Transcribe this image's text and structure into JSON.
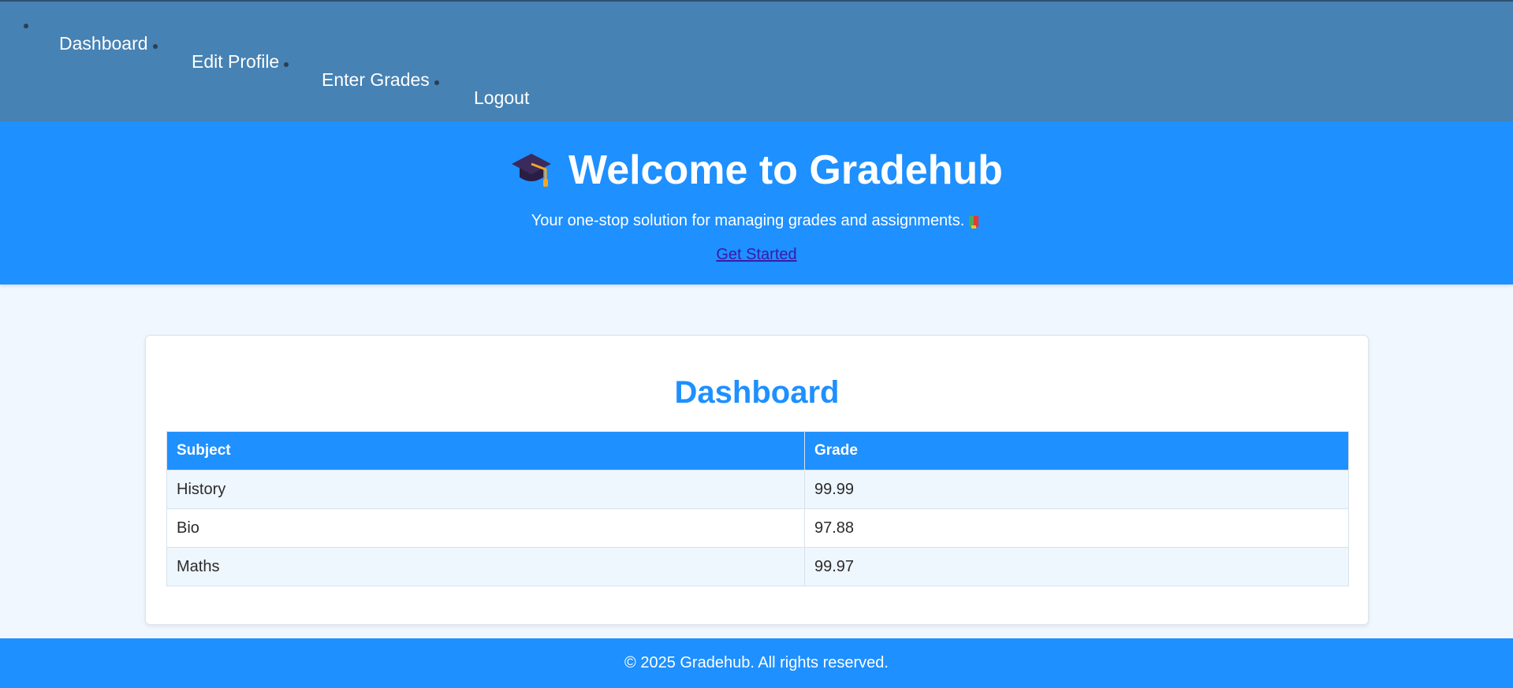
{
  "nav": {
    "items": [
      {
        "label": "Dashboard"
      },
      {
        "label": "Edit Profile"
      },
      {
        "label": "Enter Grades"
      },
      {
        "label": "Logout"
      }
    ]
  },
  "hero": {
    "title": "Welcome to Gradehub",
    "title_icon": "graduation-cap-icon",
    "tagline": "Your one-stop solution for managing grades and assignments.",
    "tagline_icon": "books-icon",
    "cta_label": "Get Started"
  },
  "dashboard": {
    "title": "Dashboard",
    "columns": [
      "Subject",
      "Grade"
    ],
    "rows": [
      {
        "subject": "History",
        "grade": "99.99"
      },
      {
        "subject": "Bio",
        "grade": "97.88"
      },
      {
        "subject": "Maths",
        "grade": "99.97"
      }
    ]
  },
  "footer": {
    "text": "© 2025 Gradehub. All rights reserved."
  },
  "colors": {
    "nav_bg": "#4682b4",
    "primary": "#1e90ff",
    "page_bg": "#f0f7ff",
    "row_alt": "#eef6fe",
    "link": "#3a1aa8"
  }
}
